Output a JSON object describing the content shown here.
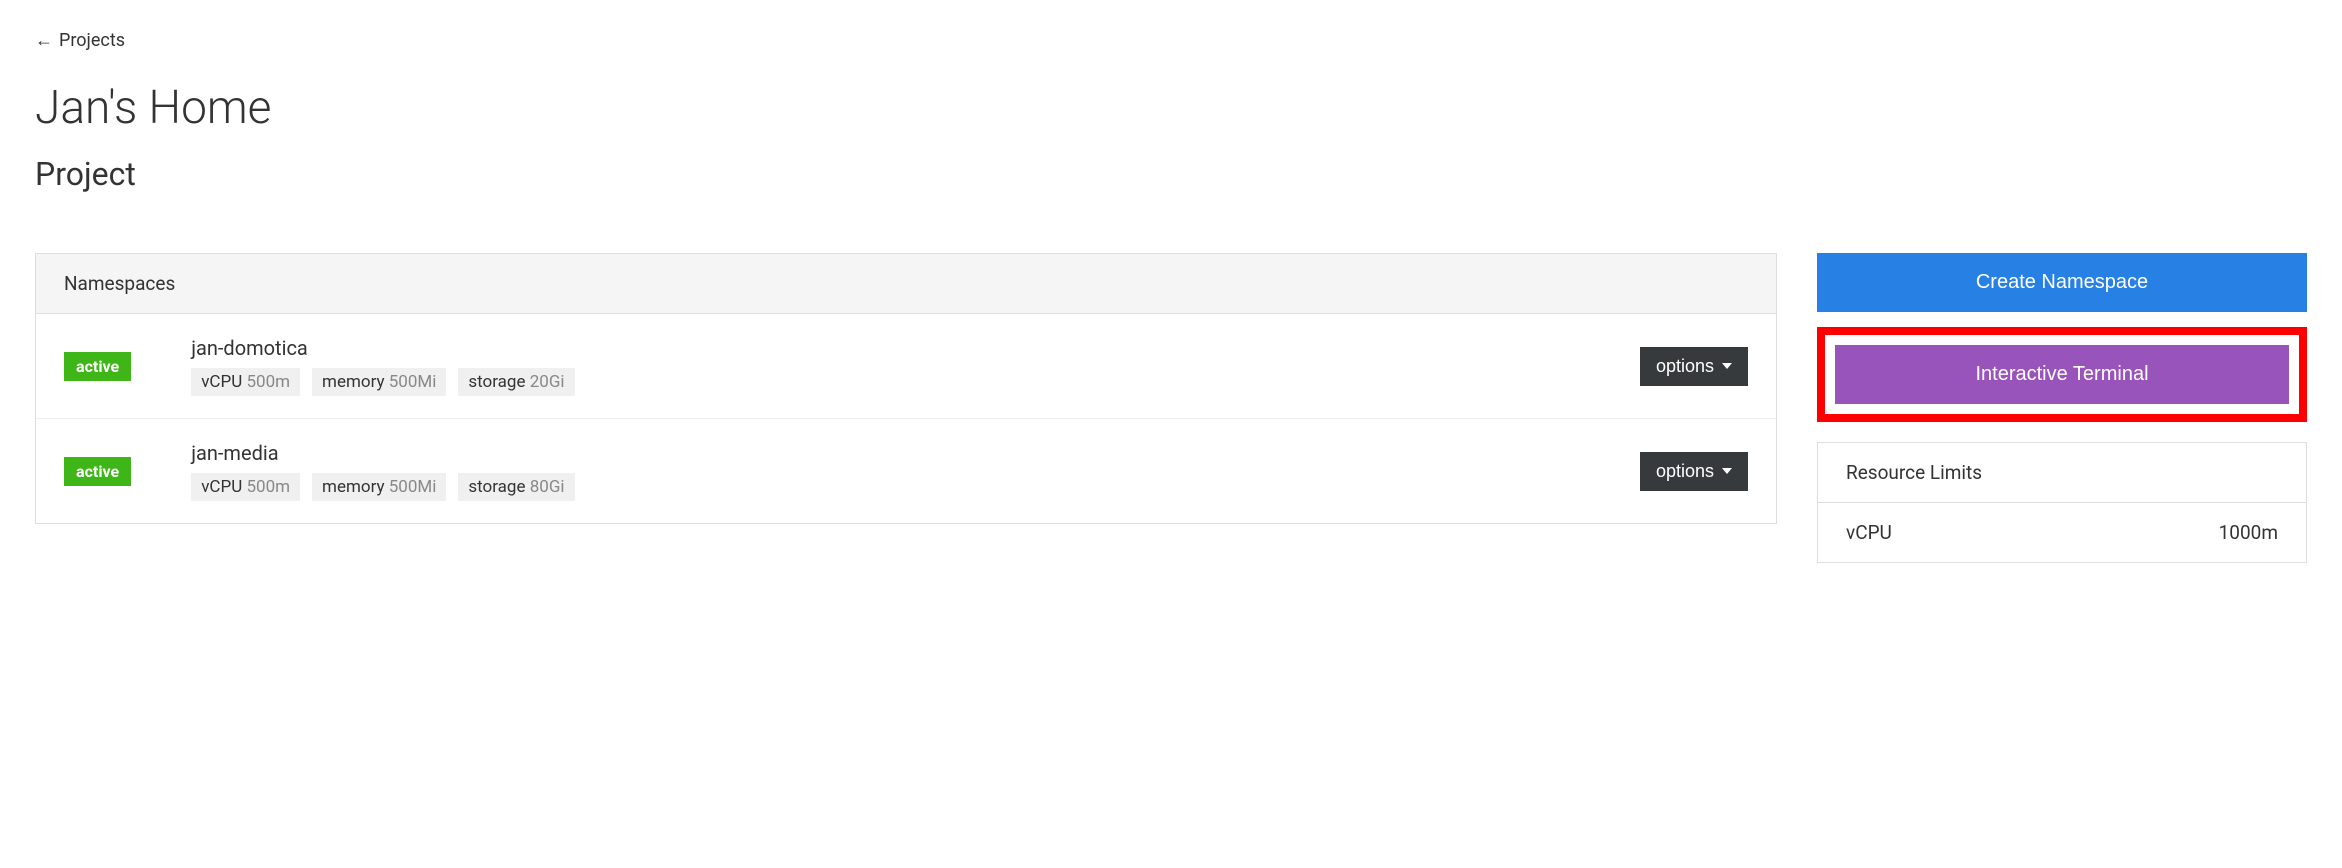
{
  "back": {
    "arrow": "←",
    "label": "Projects"
  },
  "title": "Jan's Home",
  "subtitle": "Project",
  "namespaces": {
    "header": "Namespaces",
    "items": [
      {
        "status": "active",
        "name": "jan-domotica",
        "resources": {
          "cpu_label": "vCPU",
          "cpu_value": "500m",
          "memory_label": "memory",
          "memory_value": "500Mi",
          "storage_label": "storage",
          "storage_value": "20Gi"
        },
        "options_label": "options"
      },
      {
        "status": "active",
        "name": "jan-media",
        "resources": {
          "cpu_label": "vCPU",
          "cpu_value": "500m",
          "memory_label": "memory",
          "memory_value": "500Mi",
          "storage_label": "storage",
          "storage_value": "80Gi"
        },
        "options_label": "options"
      }
    ]
  },
  "actions": {
    "create_namespace": "Create Namespace",
    "interactive_terminal": "Interactive Terminal"
  },
  "limits": {
    "header": "Resource Limits",
    "rows": [
      {
        "label": "vCPU",
        "value": "1000m"
      }
    ]
  }
}
